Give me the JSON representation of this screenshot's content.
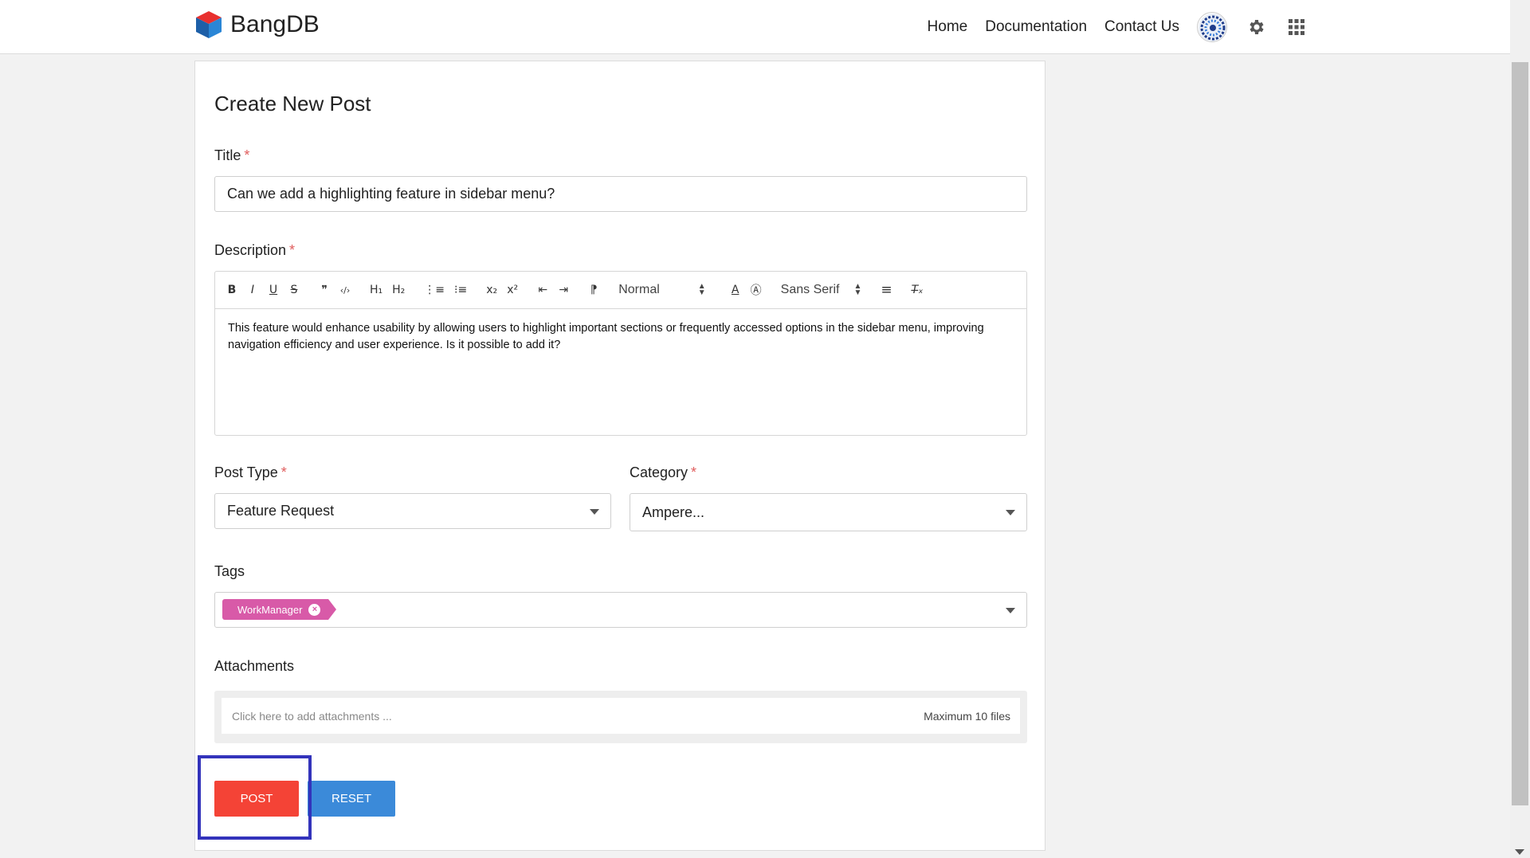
{
  "brand": {
    "name": "BangDB"
  },
  "nav": {
    "links": [
      "Home",
      "Documentation",
      "Contact Us"
    ],
    "icons": [
      "avatar",
      "gear-icon",
      "apps-grid-icon"
    ]
  },
  "form": {
    "heading": "Create New Post",
    "title_label": "Title",
    "title_value": "Can we add a highlighting feature in sidebar menu?",
    "description_label": "Description",
    "toolbar": {
      "bold": "B",
      "italic": "I",
      "underline": "U",
      "strike": "S",
      "blockquote": "❞",
      "code": "‹/›",
      "h1": "H₁",
      "h2": "H₂",
      "ordered_list": "⋮≡",
      "bullet_list": "⁝≡",
      "subscript": "x₂",
      "superscript": "x²",
      "outdent": "⇤",
      "indent": "⇥",
      "direction": "⁋",
      "size": "Normal",
      "color": "A",
      "background": "Ⓐ",
      "font": "Sans Serif",
      "align": "≡",
      "clear": "T̶ₓ"
    },
    "description_value": "This feature would enhance usability by allowing users to highlight important sections or frequently accessed options in the sidebar menu, improving navigation efficiency and user experience. Is it possible to add it?",
    "post_type_label": "Post Type",
    "post_type_value": "Feature Request",
    "category_label": "Category",
    "category_value": "Ampere...",
    "tags_label": "Tags",
    "tags": [
      "WorkManager"
    ],
    "attachments_label": "Attachments",
    "attachments_placeholder": "Click here to add attachments ...",
    "attachments_limit": "Maximum 10 files",
    "post_button": "POST",
    "reset_button": "RESET",
    "required_marker": "*"
  },
  "colors": {
    "post": "#f44336",
    "reset": "#3b8ad9",
    "tag": "#d85aa8",
    "highlight": "#3333bb",
    "required": "#e05d5d"
  }
}
